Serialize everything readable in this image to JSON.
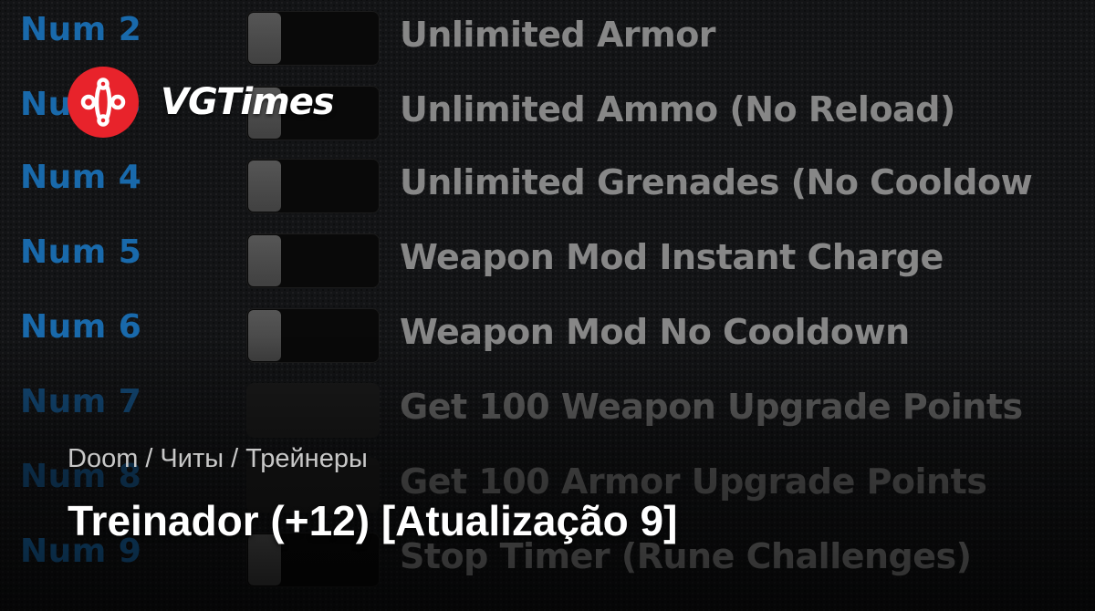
{
  "brand": {
    "name": "VGTimes",
    "accent_color": "#e8232b"
  },
  "trainer": {
    "rows": [
      {
        "hotkey": "Num 2",
        "label": "Unlimited Armor"
      },
      {
        "hotkey": "Num 3",
        "label": "Unlimited Ammo (No Reload)"
      },
      {
        "hotkey": "Num 4",
        "label": "Unlimited Grenades (No Cooldow"
      },
      {
        "hotkey": "Num 5",
        "label": "Weapon Mod Instant Charge"
      },
      {
        "hotkey": "Num 6",
        "label": "Weapon Mod No Cooldown"
      },
      {
        "hotkey": "Num 7",
        "label": "Get 100 Weapon Upgrade Points"
      },
      {
        "hotkey": "Num 8",
        "label": "Get 100 Armor Upgrade Points"
      },
      {
        "hotkey": "Num 9",
        "label": "Stop Timer (Rune Challenges)"
      }
    ],
    "hotkey_color": "#1a6fb4"
  },
  "breadcrumb": {
    "items": [
      "Doom",
      "Читы",
      "Трейнеры"
    ],
    "separator": "/"
  },
  "title": "Treinador (+12) [Atualização 9]"
}
